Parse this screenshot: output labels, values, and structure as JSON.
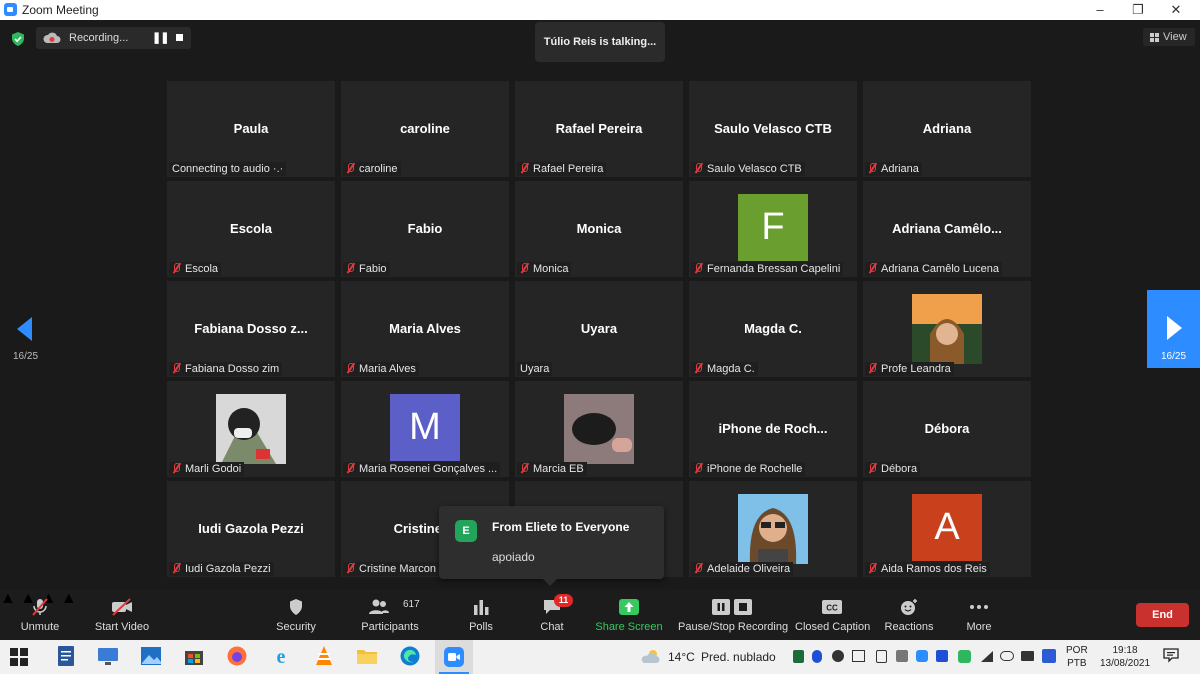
{
  "window": {
    "title": "Zoom Meeting",
    "controls": [
      "–",
      "❐",
      "✕"
    ]
  },
  "recording": {
    "label": "Recording...",
    "pause_icon": "pause-icon",
    "stop_icon": "stop-icon"
  },
  "talking": "Túlio Reis is talking...",
  "view": {
    "label": "View"
  },
  "pager": {
    "left": "16/25",
    "right": "16/25"
  },
  "tiles": [
    {
      "name": "Paula",
      "label": "Connecting to audio ·.·",
      "muted": false
    },
    {
      "name": "caroline",
      "label": "caroline",
      "muted": true
    },
    {
      "name": "Rafael Pereira",
      "label": "Rafael Pereira",
      "muted": true
    },
    {
      "name": "Saulo Velasco CTB",
      "label": "Saulo Velasco CTB",
      "muted": true
    },
    {
      "name": "Adriana",
      "label": "Adriana",
      "muted": true
    },
    {
      "name": "Escola",
      "label": "Escola",
      "muted": true
    },
    {
      "name": "Fabio",
      "label": "Fabio",
      "muted": true
    },
    {
      "name": "Monica",
      "label": "Monica",
      "muted": true
    },
    {
      "name": "",
      "avatar": "F",
      "avatar_color": "#6a9e2f",
      "label": "Fernanda Bressan Capelini",
      "muted": true
    },
    {
      "name": "Adriana  Camêlo...",
      "label": "Adriana Camêlo Lucena",
      "muted": true
    },
    {
      "name": "Fabiana Dosso z...",
      "label": "Fabiana Dosso zim",
      "muted": true
    },
    {
      "name": "Maria Alves",
      "label": "Maria Alves",
      "muted": true
    },
    {
      "name": "Uyara",
      "label": "Uyara",
      "muted": false
    },
    {
      "name": "Magda C.",
      "label": "Magda C.",
      "muted": true
    },
    {
      "name": "",
      "photo": "sunset",
      "label": "Profe Leandra",
      "muted": true
    },
    {
      "name": "",
      "photo": "selfie",
      "label": "Marli Godoi",
      "muted": true
    },
    {
      "name": "",
      "avatar": "M",
      "avatar_color": "#5b5fc7",
      "label": "Maria Rosenei Gonçalves ...",
      "muted": true
    },
    {
      "name": "",
      "photo": "cat",
      "label": "Marcia EB",
      "muted": true
    },
    {
      "name": "iPhone  de  Roch...",
      "label": "iPhone de Rochelle",
      "muted": true
    },
    {
      "name": "Débora",
      "label": "Débora",
      "muted": true
    },
    {
      "name": "Iudi Gazola Pezzi",
      "label": "Iudi Gazola Pezzi",
      "muted": true
    },
    {
      "name": "Cristine M",
      "label": "Cristine Marcon",
      "muted": true
    },
    {
      "name": "",
      "label": "",
      "muted": false
    },
    {
      "name": "",
      "photo": "woman",
      "label": "Adelaide Oliveira",
      "muted": true
    },
    {
      "name": "",
      "avatar": "A",
      "avatar_color": "#c8401c",
      "label": "Aida Ramos dos Reis",
      "muted": true
    }
  ],
  "chat_popup": {
    "initial": "E",
    "from": "From Eliete to Everyone",
    "message": "apoiado"
  },
  "toolbar": {
    "unmute": "Unmute",
    "start_video": "Start Video",
    "security": "Security",
    "participants": "Participants",
    "participants_count": "617",
    "polls": "Polls",
    "chat": "Chat",
    "chat_badge": "11",
    "share_screen": "Share Screen",
    "pause_stop": "Pause/Stop Recording",
    "closed_caption": "Closed Caption",
    "reactions": "Reactions",
    "more": "More",
    "end": "End"
  },
  "taskbar": {
    "weather_temp": "14°C",
    "weather_desc": "Pred. nublado",
    "lang_1": "POR",
    "lang_2": "PTB",
    "time": "19:18",
    "date": "13/08/2021"
  }
}
